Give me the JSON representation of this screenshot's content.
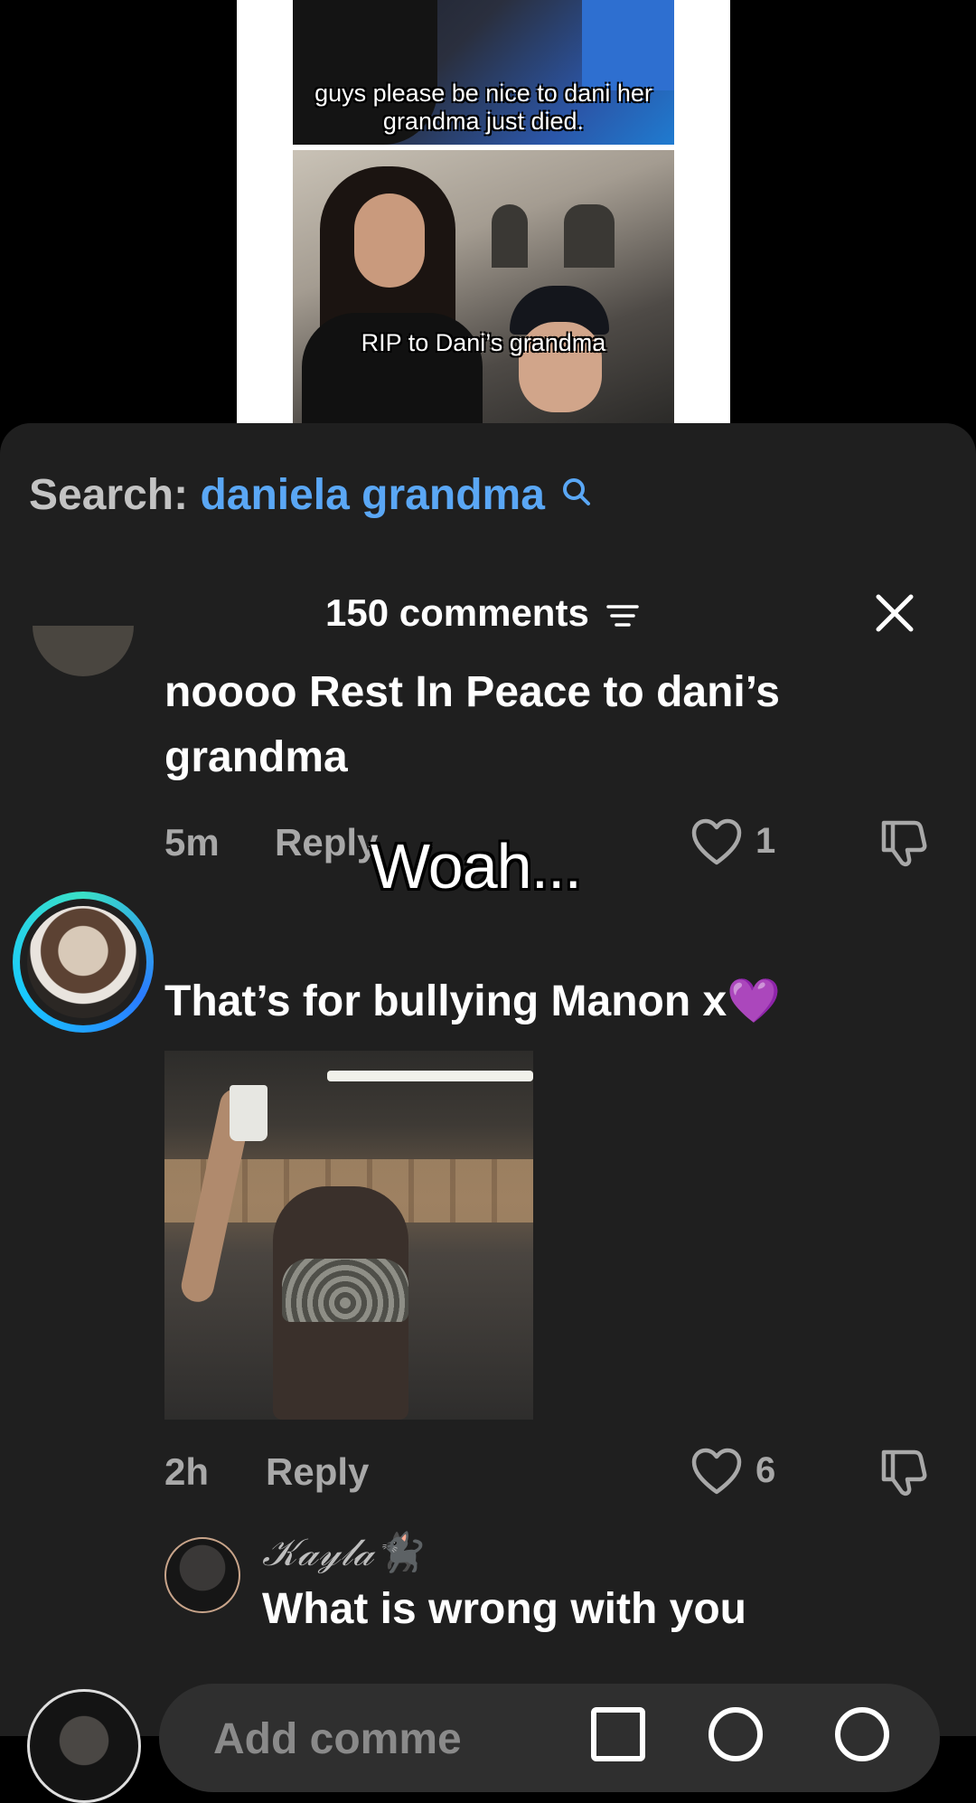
{
  "video": {
    "caption_top": "guys please be nice to dani her grandma just died.",
    "caption_bottom": "RIP to Dani’s grandma"
  },
  "search": {
    "label": "Search:",
    "query": "daniela grandma",
    "icon": "search-icon"
  },
  "header": {
    "count_label": "150 comments",
    "sort_icon": "sort-lines-icon",
    "close_icon": "close-icon"
  },
  "overlay": {
    "text": "Woah..."
  },
  "comments": [
    {
      "text": "noooo Rest In Peace to dani’s grandma",
      "time": "5m",
      "reply_label": "Reply",
      "likes": "1"
    },
    {
      "text": "That’s for bullying Manon x💜",
      "time": "2h",
      "reply_label": "Reply",
      "likes": "6",
      "has_gif": true
    }
  ],
  "replies": [
    {
      "name": "𝒦𝒶𝓎𝓁𝒶🐈‍⬛",
      "text": "What is wrong with you"
    }
  ],
  "composer": {
    "placeholder": "Add comme"
  },
  "colors": {
    "sheet_bg": "#1f1f1f",
    "search_query": "#5aa7f5",
    "meta_text": "#a8a8a8",
    "avatar_ring": "#3ae0c6"
  }
}
